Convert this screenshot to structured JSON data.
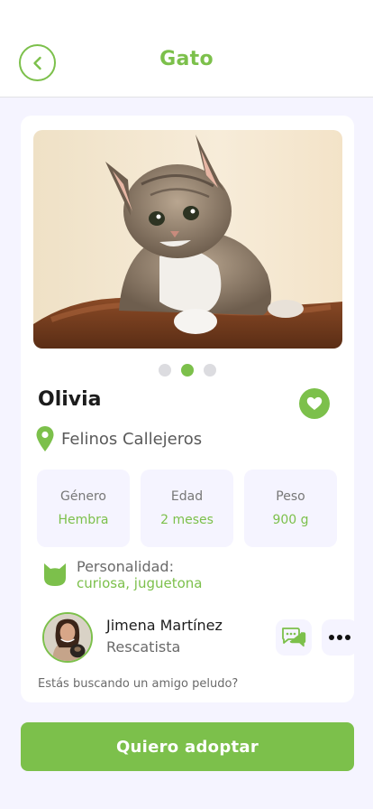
{
  "colors": {
    "accent": "#7cc04b",
    "background": "#f5f4ff",
    "card": "#ffffff",
    "text": "#1c1c1c"
  },
  "header": {
    "title": "Gato",
    "back_icon": "chevron-left-icon"
  },
  "gallery": {
    "image": "kitten-photo",
    "page_count": 3,
    "active_page": 2
  },
  "pet": {
    "name": "Olivia",
    "favorite_icon": "heart-icon",
    "shelter": "Felinos Callejeros",
    "shelter_icon": "location-pin-icon"
  },
  "stats": [
    {
      "label": "Género",
      "value": "Hembra"
    },
    {
      "label": "Edad",
      "value": "2 meses"
    },
    {
      "label": "Peso",
      "value": "900 g"
    }
  ],
  "personality": {
    "label": "Personalidad:",
    "value": "curiosa, juguetona",
    "icon": "cat-icon"
  },
  "rescuer": {
    "name": "Jimena Martínez",
    "role": "Rescatista",
    "chat_icon": "chat-icon",
    "more_icon": "more-dots-icon"
  },
  "teaser": "Estás buscando un amigo peludo?",
  "cta": {
    "label": "Quiero adoptar"
  }
}
